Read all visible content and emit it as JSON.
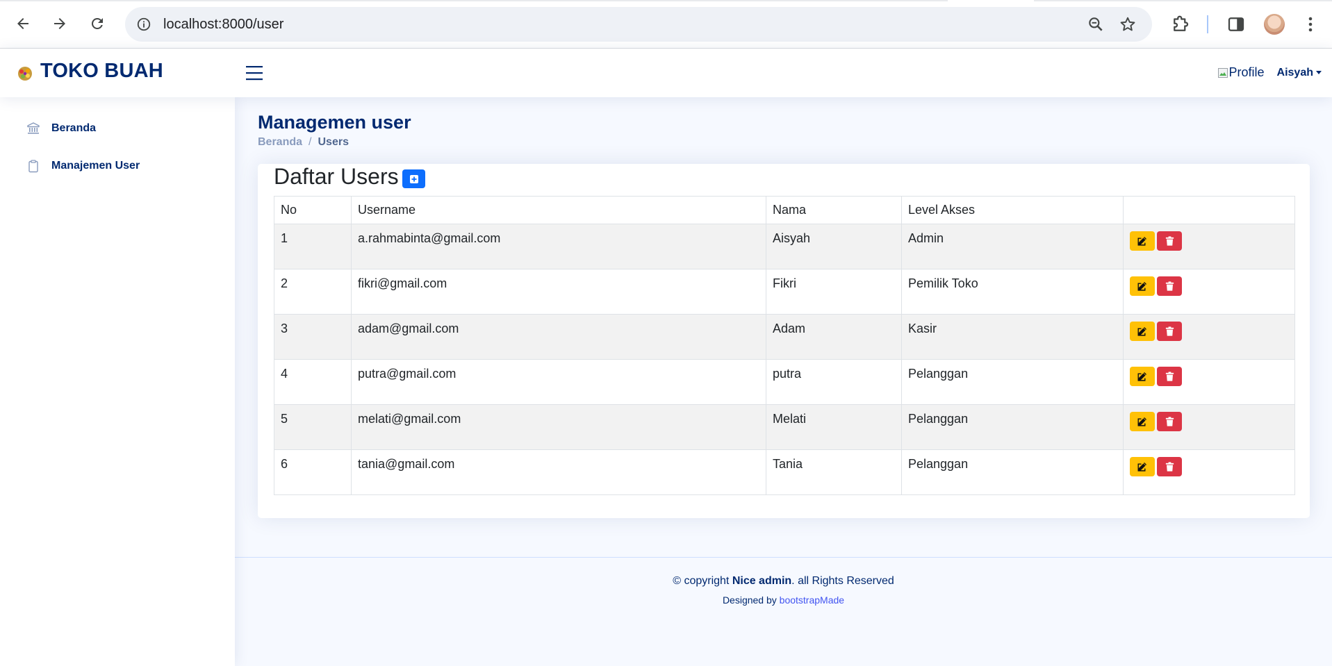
{
  "browser": {
    "url": "localhost:8000/user"
  },
  "header": {
    "brand": "TOKO BUAH",
    "profile_alt": "Profile",
    "profile_name": "Aisyah"
  },
  "sidebar": {
    "items": [
      {
        "label": "Beranda",
        "icon": "bank-icon"
      },
      {
        "label": "Manajemen User",
        "icon": "clipboard-icon"
      }
    ]
  },
  "page": {
    "title": "Managemen user",
    "breadcrumb": [
      "Beranda",
      "Users"
    ]
  },
  "card": {
    "title": "Daftar Users"
  },
  "table": {
    "headers": [
      "No",
      "Username",
      "Nama",
      "Level Akses",
      ""
    ],
    "rows": [
      {
        "no": "1",
        "username": "a.rahmabinta@gmail.com",
        "nama": "Aisyah",
        "level": "Admin"
      },
      {
        "no": "2",
        "username": "fikri@gmail.com",
        "nama": "Fikri",
        "level": "Pemilik Toko"
      },
      {
        "no": "3",
        "username": "adam@gmail.com",
        "nama": "Adam",
        "level": "Kasir"
      },
      {
        "no": "4",
        "username": "putra@gmail.com",
        "nama": "putra",
        "level": "Pelanggan"
      },
      {
        "no": "5",
        "username": "melati@gmail.com",
        "nama": "Melati",
        "level": "Pelanggan"
      },
      {
        "no": "6",
        "username": "tania@gmail.com",
        "nama": "Tania",
        "level": "Pelanggan"
      }
    ]
  },
  "footer": {
    "copyright_prefix": "© copyright",
    "copyright_brand": "Nice admin",
    "copyright_suffix": ". all Rights Reserved",
    "designed_by": "Designed by",
    "designer": "bootstrapMade"
  },
  "colors": {
    "brand": "#012970",
    "primary": "#0d6efd",
    "warning": "#ffc107",
    "danger": "#dc3545",
    "page_bg": "#f6f9ff"
  }
}
